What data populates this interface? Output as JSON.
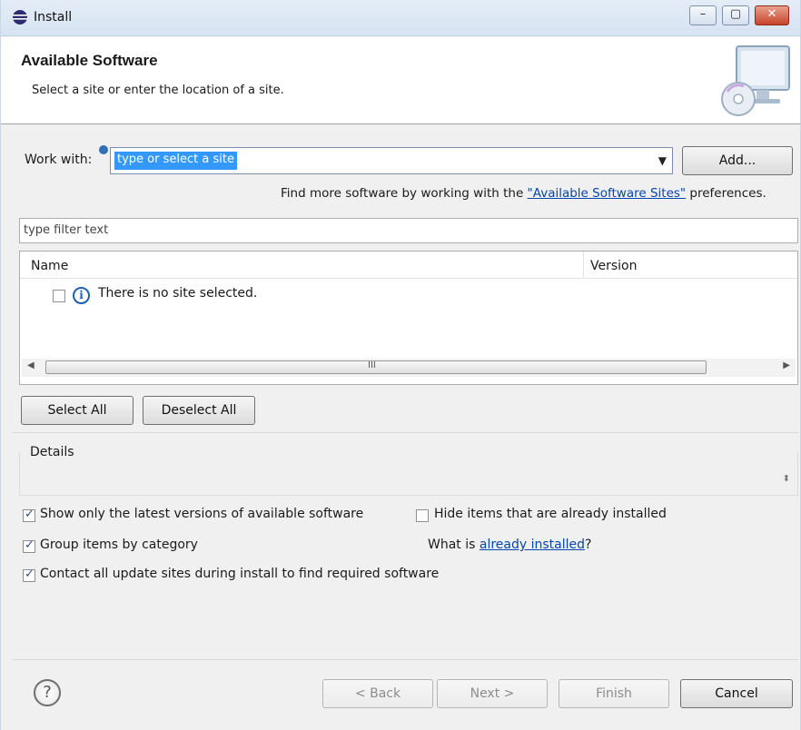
{
  "window": {
    "title": "Install",
    "minimize": "–",
    "maximize": "▢",
    "close": "✕"
  },
  "header": {
    "heading": "Available Software",
    "subtitle": "Select a site or enter the location of a site."
  },
  "work_with": {
    "label": "Work with:",
    "value": "type or select a site",
    "add_button": "Add...",
    "hint_prefix": "Find more software by working with the ",
    "hint_link": "\"Available Software Sites\"",
    "hint_suffix": " preferences."
  },
  "filter": {
    "placeholder": "type filter text"
  },
  "tree": {
    "columns": [
      "Name",
      "Version"
    ],
    "rows": [
      {
        "text": "There is no site selected.",
        "checked": false
      }
    ],
    "scroll_thumb_grip": "III"
  },
  "selection_buttons": {
    "select_all": "Select All",
    "deselect_all": "Deselect All"
  },
  "details": {
    "label": "Details"
  },
  "options": {
    "latest_versions": {
      "label": "Show only the latest versions of available software",
      "checked": true
    },
    "hide_installed": {
      "label": "Hide items that are already installed",
      "checked": false
    },
    "group_by_category": {
      "label": "Group items by category",
      "checked": true
    },
    "what_is_prefix": "What is ",
    "what_is_link": "already installed",
    "what_is_suffix": "?",
    "contact_sites": {
      "label": "Contact all update sites during install to find required software",
      "checked": true
    }
  },
  "footer": {
    "help": "?",
    "back": "< Back",
    "next": "Next >",
    "finish": "Finish",
    "cancel": "Cancel"
  }
}
